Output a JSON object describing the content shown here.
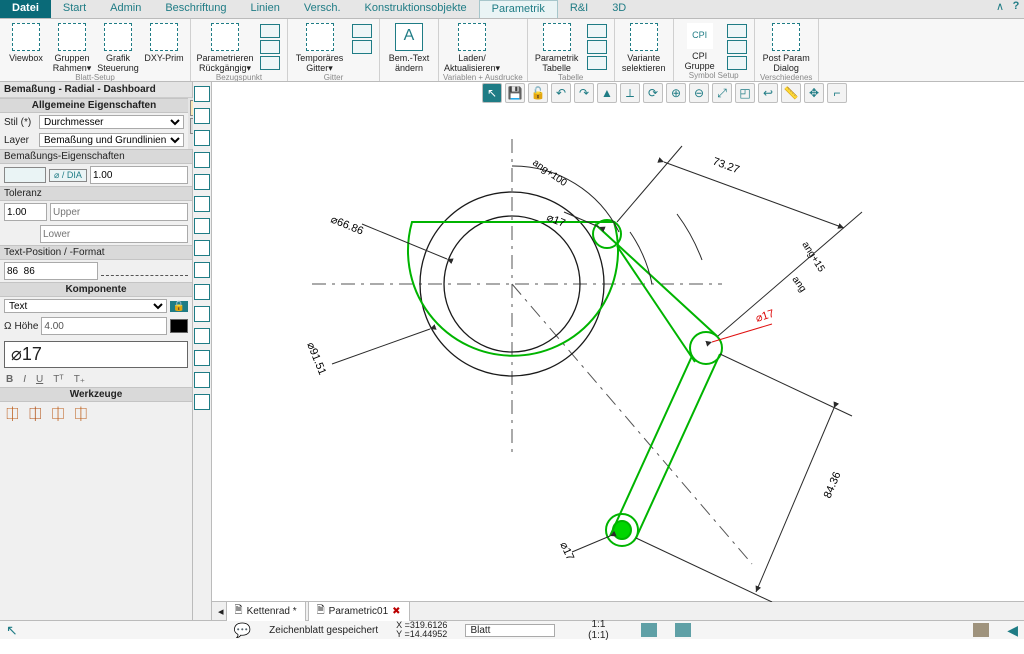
{
  "menu": {
    "file": "Datei",
    "tabs": [
      "Start",
      "Admin",
      "Beschriftung",
      "Linien",
      "Versch.",
      "Konstruktionsobjekte",
      "Parametrik",
      "R&I",
      "3D"
    ],
    "active": "Parametrik"
  },
  "ribbon": {
    "groups": [
      {
        "name": "Blatt-Setup",
        "buttons": [
          "Viewbox",
          "Gruppen Rahmen▾",
          "Grafik Steuerung",
          "DXY-Prim"
        ]
      },
      {
        "name": "Bezugspunkt",
        "buttons": [
          "Parametrieren Rückgängig▾"
        ]
      },
      {
        "name": "Gitter",
        "buttons": [
          "Temporäres Gitter▾"
        ]
      },
      {
        "name": "",
        "buttons": [
          "Bem.-Text ändern"
        ]
      },
      {
        "name": "Variablen + Ausdrucke",
        "buttons": [
          "Laden/ Aktualisieren▾"
        ]
      },
      {
        "name": "Tabelle",
        "buttons": [
          "Parametrik Tabelle"
        ]
      },
      {
        "name": "",
        "buttons": [
          "Variante selektieren"
        ]
      },
      {
        "name": "Symbol Setup",
        "buttons": [
          "CPI Gruppe"
        ]
      },
      {
        "name": "Verschiedenes",
        "buttons": [
          "Post Param Dialog"
        ]
      }
    ]
  },
  "dashboard": {
    "title": "Bemaßung - Radial - Dashboard",
    "sections": {
      "general": "Allgemeine Eigenschaften",
      "dimprops": "Bemaßungs-Eigenschaften",
      "tolerance": "Toleranz",
      "textpos": "Text-Position / -Format",
      "component": "Komponente",
      "tools": "Werkzeuge"
    },
    "labels": {
      "style": "Stil (*)",
      "layer": "Layer",
      "upper": "Upper",
      "lower": "Lower",
      "hoehe": "Höhe"
    },
    "styleValue": "Durchmesser",
    "layerValue": "Bemaßung und Grundlinien",
    "diaBadge": "⌀ / DIA",
    "dimScale": "1.00",
    "tolValue": "1.00",
    "textPosVal": "86  86",
    "componentType": "Text",
    "heightValue": "4.00",
    "dimValue": "⌀17"
  },
  "canvasToolbar": {
    "icons": [
      "↖",
      "💾",
      "🔓",
      "↶",
      "↷",
      "▲",
      "⟂",
      "⟳",
      "🔍",
      "🔍",
      "🔍",
      "🔍",
      "🔍",
      "✎",
      "⤢",
      "⌐"
    ]
  },
  "drawing": {
    "dims": {
      "d1": "⌀66.86",
      "d2": "⌀91.51",
      "d3": "⌀17",
      "d4": "⌀17",
      "d5": "⌀17",
      "linear1": "73.27",
      "linear2": "84.36",
      "ang1": "ang+100",
      "ang2": "ang+15",
      "ang3": "ang"
    }
  },
  "docTabs": [
    "Kettenrad *",
    "Parametric01"
  ],
  "status": {
    "saved": "Zeichenblatt gespeichert",
    "x": "X =319.6126",
    "y": "Y =14.44952",
    "sheet": "Blatt",
    "scale1": "1:1",
    "scale2": "(1:1)"
  }
}
